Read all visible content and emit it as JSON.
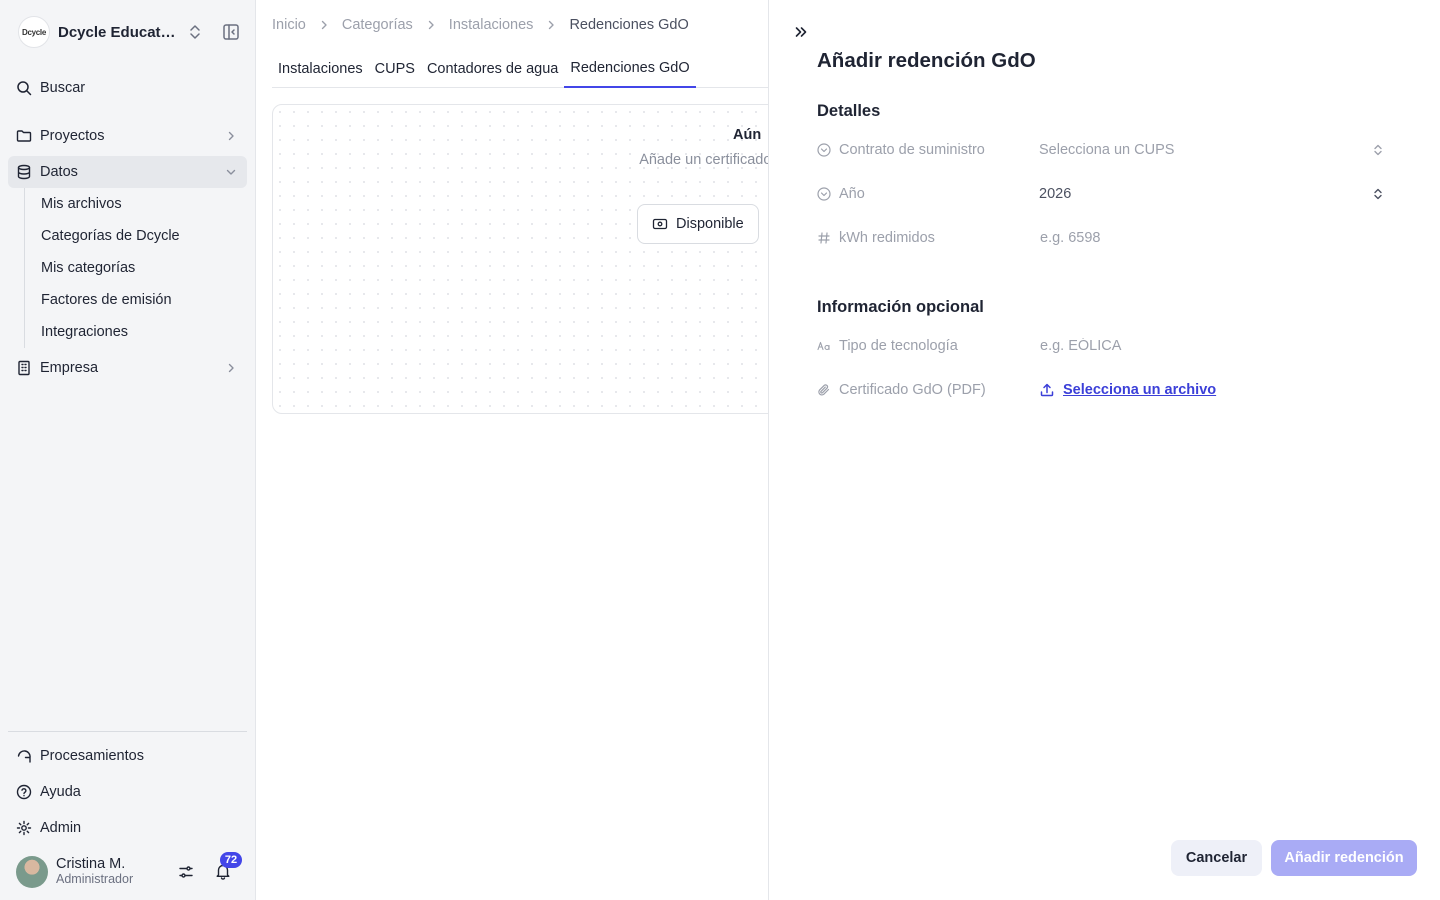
{
  "sidebar": {
    "org_logo_text": "Dcycle",
    "org_name": "Dcycle Education",
    "search_label": "Buscar",
    "items": [
      {
        "label": "Proyectos"
      },
      {
        "label": "Datos"
      },
      {
        "label": "Empresa"
      }
    ],
    "data_subitems": [
      {
        "label": "Mis archivos"
      },
      {
        "label": "Categorías de Dcycle"
      },
      {
        "label": "Mis categorías"
      },
      {
        "label": "Factores de emisión"
      },
      {
        "label": "Integraciones"
      }
    ],
    "bottom_items": [
      {
        "label": "Procesamientos"
      },
      {
        "label": "Ayuda"
      },
      {
        "label": "Admin"
      }
    ],
    "user": {
      "name": "Cristina M.",
      "role": "Administrador",
      "notifications": "72"
    }
  },
  "main": {
    "breadcrumb": [
      "Inicio",
      "Categorías",
      "Instalaciones",
      "Redenciones GdO"
    ],
    "tabs": [
      {
        "label": "Instalaciones",
        "active": false
      },
      {
        "label": "CUPS",
        "active": false
      },
      {
        "label": "Contadores de agua",
        "active": false
      },
      {
        "label": "Redenciones GdO",
        "active": true
      }
    ],
    "empty_state": {
      "title": "Aún",
      "description": "Añade un certificado emisiones negativas",
      "button_label": "Disponible"
    }
  },
  "drawer": {
    "title": "Añadir redención GdO",
    "details_title": "Detalles",
    "fields": {
      "supply_contract": {
        "label": "Contrato de suministro",
        "placeholder": "Selecciona un CUPS"
      },
      "year": {
        "label": "Año",
        "value": "2026"
      },
      "kwh": {
        "label": "kWh redimidos",
        "placeholder": "e.g. 6598"
      }
    },
    "optional_title": "Información opcional",
    "optional_fields": {
      "technology": {
        "label": "Tipo de tecnología",
        "placeholder": "e.g. EÓLICA"
      },
      "certificate": {
        "label": "Certificado GdO (PDF)",
        "link_label": "Selecciona un archivo"
      }
    },
    "cancel_label": "Cancelar",
    "submit_label": "Añadir redención"
  },
  "colors": {
    "accent": "#4346e8",
    "accent_disabled": "#a9abf5",
    "sidebar_bg": "#f4f5f7"
  }
}
